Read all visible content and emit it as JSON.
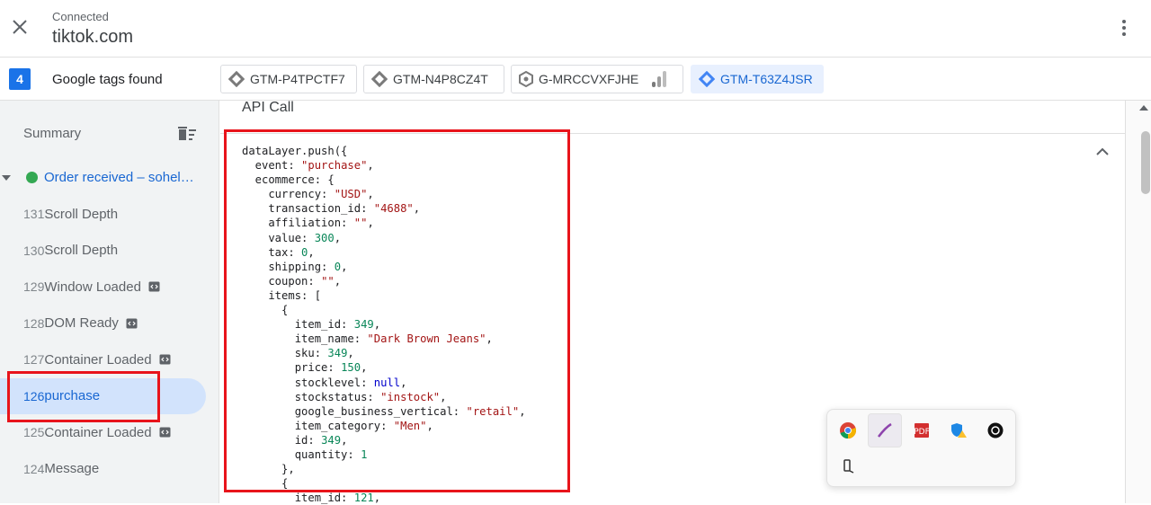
{
  "header": {
    "status": "Connected",
    "host": "tiktok.com"
  },
  "tags_bar": {
    "count": "4",
    "label": "Google tags found",
    "chips": [
      "GTM-P4TPCTF7",
      "GTM-N4P8CZ4T",
      "G-MRCCVXFJHE",
      "GTM-T63Z4JSR"
    ],
    "selected_chip": "GTM-T63Z4JSR"
  },
  "sidebar": {
    "summary_label": "Summary",
    "page_item": "Order received – sohel…",
    "events": [
      {
        "num": "131",
        "name": "Scroll Depth",
        "code_icon": false
      },
      {
        "num": "130",
        "name": "Scroll Depth",
        "code_icon": false
      },
      {
        "num": "129",
        "name": "Window Loaded",
        "code_icon": true
      },
      {
        "num": "128",
        "name": "DOM Ready",
        "code_icon": true
      },
      {
        "num": "127",
        "name": "Container Loaded",
        "code_icon": true
      },
      {
        "num": "126",
        "name": "purchase",
        "code_icon": false,
        "selected": true
      },
      {
        "num": "125",
        "name": "Container Loaded",
        "code_icon": true
      },
      {
        "num": "124",
        "name": "Message",
        "code_icon": false
      }
    ]
  },
  "main": {
    "section_title": "API Call",
    "code_lines": [
      "dataLayer.push({",
      "  event: \"purchase\",",
      "  ecommerce: {",
      "    currency: \"USD\",",
      "    transaction_id: \"4688\",",
      "    affiliation: \"\",",
      "    value: 300,",
      "    tax: 0,",
      "    shipping: 0,",
      "    coupon: \"\",",
      "    items: [",
      "      {",
      "        item_id: 349,",
      "        item_name: \"Dark Brown Jeans\",",
      "        sku: 349,",
      "        price: 150,",
      "        stocklevel: null,",
      "        stockstatus: \"instock\",",
      "        google_business_vertical: \"retail\",",
      "        item_category: \"Men\",",
      "        id: 349,",
      "        quantity: 1",
      "      },",
      "      {",
      "        item_id: 121,"
    ]
  },
  "tray_icons": [
    "chrome-icon",
    "pen-icon",
    "pdf-icon",
    "shield-warning-icon",
    "app-icon",
    "usb-icon"
  ],
  "colors": {
    "accent": "#1a73e8",
    "selected_bg": "#d2e3fc",
    "highlight_border": "#e8141b",
    "status_green": "#34a853"
  }
}
